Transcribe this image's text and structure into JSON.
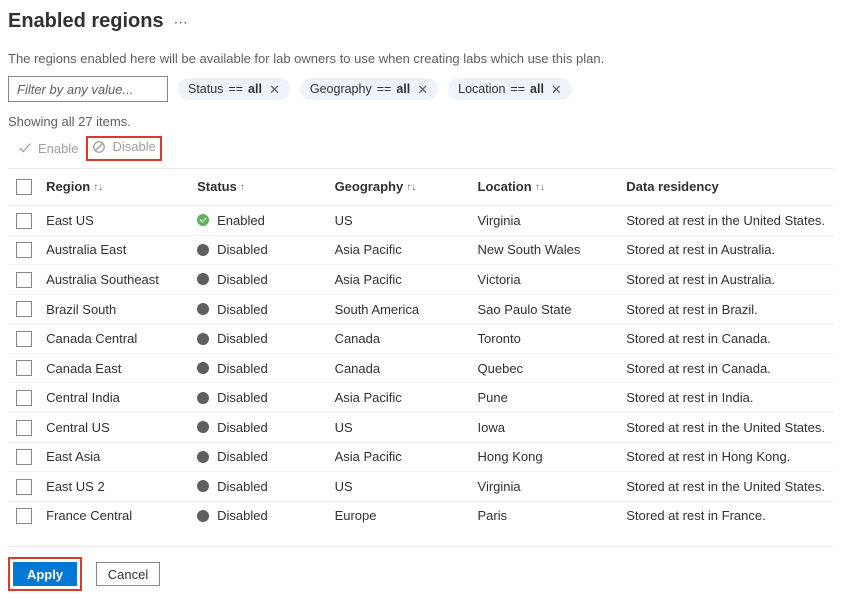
{
  "header": {
    "title": "Enabled regions",
    "description": "The regions enabled here will be available for lab owners to use when creating labs which use this plan."
  },
  "filter": {
    "placeholder": "Filter by any value...",
    "pills": [
      {
        "key": "Status",
        "value": "all"
      },
      {
        "key": "Geography",
        "value": "all"
      },
      {
        "key": "Location",
        "value": "all"
      }
    ]
  },
  "count": {
    "text": "Showing all 27 items."
  },
  "actions": {
    "enable_label": "Enable",
    "disable_label": "Disable"
  },
  "columns": {
    "region": "Region",
    "status": "Status",
    "geography": "Geography",
    "location": "Location",
    "residency": "Data residency"
  },
  "rows": [
    {
      "region": "East US",
      "status": "Enabled",
      "geo": "US",
      "loc": "Virginia",
      "res": "Stored at rest in the United States."
    },
    {
      "region": "Australia East",
      "status": "Disabled",
      "geo": "Asia Pacific",
      "loc": "New South Wales",
      "res": "Stored at rest in Australia."
    },
    {
      "region": "Australia Southeast",
      "status": "Disabled",
      "geo": "Asia Pacific",
      "loc": "Victoria",
      "res": "Stored at rest in Australia."
    },
    {
      "region": "Brazil South",
      "status": "Disabled",
      "geo": "South America",
      "loc": "Sao Paulo State",
      "res": "Stored at rest in Brazil."
    },
    {
      "region": "Canada Central",
      "status": "Disabled",
      "geo": "Canada",
      "loc": "Toronto",
      "res": "Stored at rest in Canada."
    },
    {
      "region": "Canada East",
      "status": "Disabled",
      "geo": "Canada",
      "loc": "Quebec",
      "res": "Stored at rest in Canada."
    },
    {
      "region": "Central India",
      "status": "Disabled",
      "geo": "Asia Pacific",
      "loc": "Pune",
      "res": "Stored at rest in India."
    },
    {
      "region": "Central US",
      "status": "Disabled",
      "geo": "US",
      "loc": "Iowa",
      "res": "Stored at rest in the United States."
    },
    {
      "region": "East Asia",
      "status": "Disabled",
      "geo": "Asia Pacific",
      "loc": "Hong Kong",
      "res": "Stored at rest in Hong Kong."
    },
    {
      "region": "East US 2",
      "status": "Disabled",
      "geo": "US",
      "loc": "Virginia",
      "res": "Stored at rest in the United States."
    },
    {
      "region": "France Central",
      "status": "Disabled",
      "geo": "Europe",
      "loc": "Paris",
      "res": "Stored at rest in France."
    }
  ],
  "footer": {
    "apply": "Apply",
    "cancel": "Cancel"
  }
}
